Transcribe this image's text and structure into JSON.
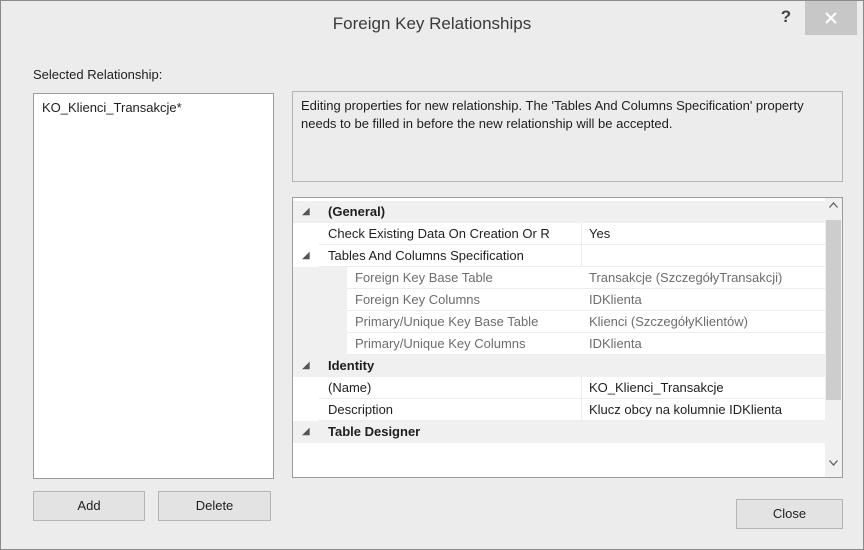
{
  "window": {
    "title": "Foreign Key Relationships",
    "help_label": "?"
  },
  "left_panel": {
    "selected_label": "Selected Relationship:",
    "items": [
      "KO_Klienci_Transakcje*"
    ],
    "add_label": "Add",
    "delete_label": "Delete"
  },
  "description": "Editing properties for new relationship.  The 'Tables And Columns Specification' property needs to be filled in before the new relationship will be accepted.",
  "properties": {
    "general": {
      "label": "(General)",
      "check_existing": {
        "name": "Check Existing Data On Creation Or R",
        "value": "Yes"
      },
      "tables_spec": {
        "name": "Tables And Columns Specification",
        "fk_base_table": {
          "name": "Foreign Key Base Table",
          "value": "Transakcje (SzczegółyTransakcji)"
        },
        "fk_columns": {
          "name": "Foreign Key Columns",
          "value": "IDKlienta"
        },
        "pk_base_table": {
          "name": "Primary/Unique Key Base Table",
          "value": "Klienci (SzczegółyKlientów)"
        },
        "pk_columns": {
          "name": "Primary/Unique Key Columns",
          "value": "IDKlienta"
        }
      }
    },
    "identity": {
      "label": "Identity",
      "name_prop": {
        "name": "(Name)",
        "value": "KO_Klienci_Transakcje"
      },
      "description_prop": {
        "name": "Description",
        "value": "Klucz obcy na kolumnie IDKlienta"
      }
    },
    "table_designer": {
      "label": "Table Designer"
    }
  },
  "footer": {
    "close_label": "Close"
  },
  "colors": {
    "titlebar": "#ececec",
    "close_button_bg": "#c7c7c7",
    "grid_bg": "#ffffff"
  },
  "icons": [
    "close-icon",
    "expand-collapse-icon",
    "scroll-up-arrow",
    "scroll-down-arrow"
  ]
}
